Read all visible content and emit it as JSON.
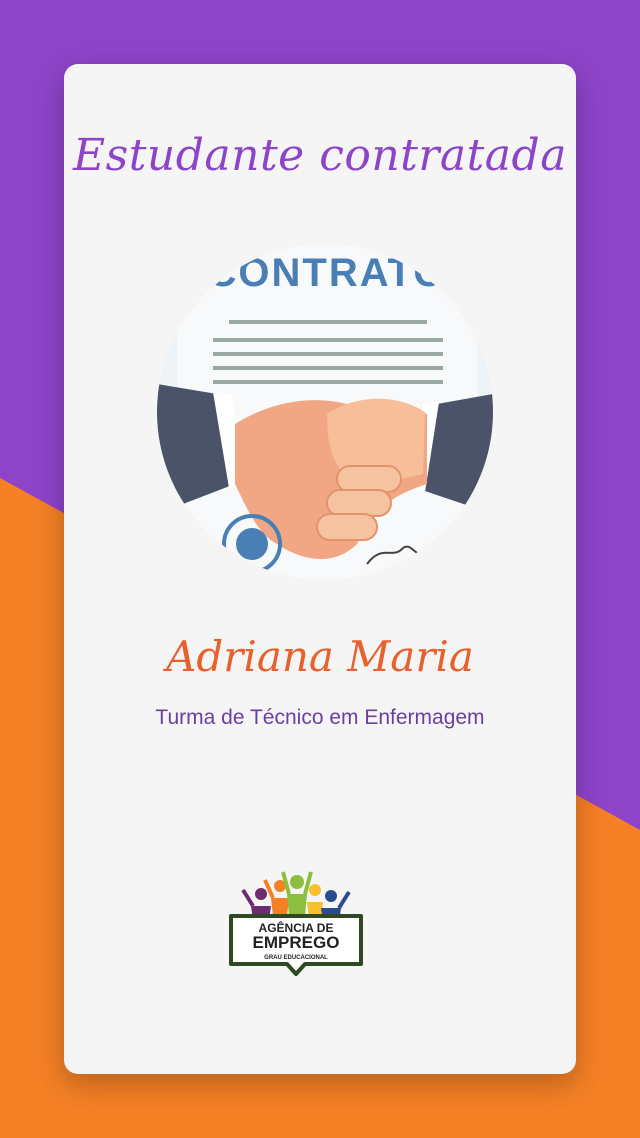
{
  "card": {
    "title": "Estudante contratada",
    "name": "Adriana Maria",
    "subtitle": "Turma de Técnico em Enfermagem"
  },
  "photo": {
    "document_text": "CONTRATO"
  },
  "logo": {
    "line1": "AGÊNCIA DE",
    "line2": "EMPREGO",
    "line3": "GRAU EDUCACIONAL"
  },
  "colors": {
    "purple": "#8e44c9",
    "orange": "#f58025",
    "name_orange": "#e8602c",
    "subtitle_purple": "#6b3fa0",
    "card_bg": "#f5f5f5"
  }
}
